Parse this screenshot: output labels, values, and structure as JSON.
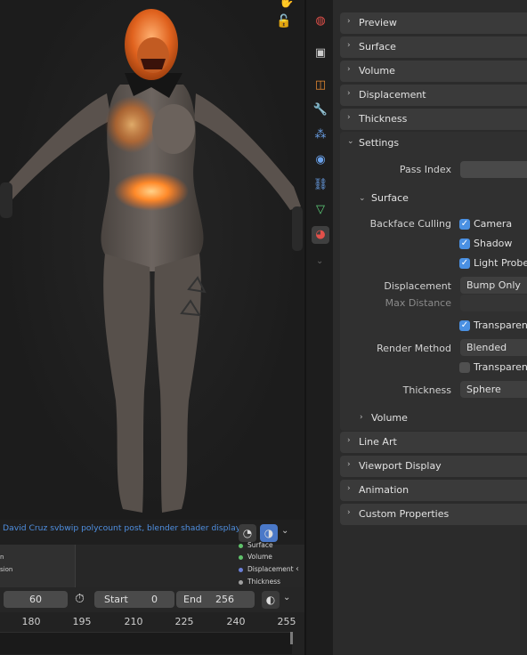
{
  "viewport": {
    "icons": {
      "hand": "hand-icon",
      "lock": "unlock-icon"
    }
  },
  "info_bar": {
    "text": "David Cruz svbwip polycount post, blender shader display.",
    "buttons": [
      "overlay-icon",
      "shading-icon"
    ]
  },
  "node_editor": {
    "left_lines": [
      "n",
      "sion"
    ],
    "sockets": [
      {
        "label": "Surface",
        "color": "#5fc26b"
      },
      {
        "label": "Volume",
        "color": "#5fc26b"
      },
      {
        "label": "Displacement",
        "color": "#6a7fd6"
      },
      {
        "label": "Thickness",
        "color": "#a0a0a0"
      }
    ]
  },
  "timeline": {
    "current_frame": "60",
    "start_label": "Start",
    "start_value": "0",
    "end_label": "End",
    "end_value": "256",
    "ruler": [
      "180",
      "195",
      "210",
      "225",
      "240",
      "255"
    ]
  },
  "properties": {
    "panels_top": [
      {
        "label": "Preview",
        "open": false
      },
      {
        "label": "Surface",
        "open": false
      },
      {
        "label": "Volume",
        "open": false
      },
      {
        "label": "Displacement",
        "open": false
      },
      {
        "label": "Thickness",
        "open": false
      }
    ],
    "settings": {
      "label": "Settings",
      "pass_index_label": "Pass Index",
      "pass_index_value": "",
      "surface_label": "Surface",
      "backface_culling_label": "Backface Culling",
      "camera_label": "Camera",
      "shadow_label": "Shadow",
      "light_probe_label": "Light Probe",
      "displacement_label": "Displacement",
      "displacement_value": "Bump Only",
      "max_distance_label": "Max Distance",
      "transparent_label": "Transparen",
      "render_method_label": "Render Method",
      "render_method_value": "Blended",
      "transparent2_label": "Transparen",
      "thickness_label": "Thickness",
      "thickness_value": "Sphere",
      "volume_label": "Volume"
    },
    "panels_bottom": [
      {
        "label": "Line Art"
      },
      {
        "label": "Viewport Display"
      },
      {
        "label": "Animation"
      },
      {
        "label": "Custom Properties"
      }
    ]
  },
  "tabs": [
    "world-icon",
    "collection-icon",
    "object-icon",
    "modifier-icon",
    "particles-icon",
    "physics-icon",
    "constraints-icon",
    "data-icon",
    "material-icon"
  ]
}
